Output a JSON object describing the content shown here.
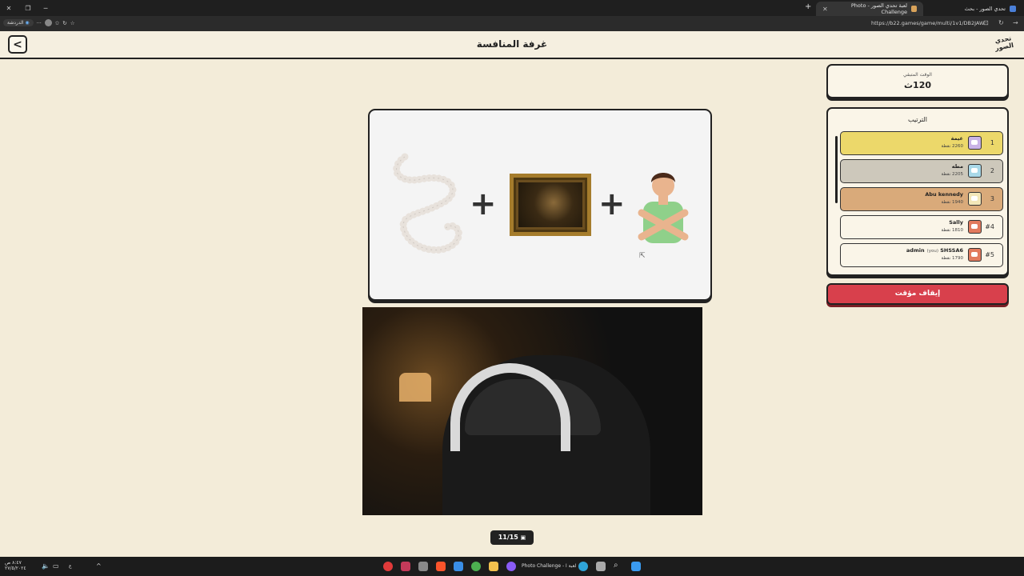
{
  "browser": {
    "tabs": [
      {
        "title": "تحدي الصور - بحث"
      },
      {
        "title": "لعبة تحدي الصور - Photo Challenge"
      }
    ],
    "url": "https://b22.games/game/multi/1v1/DB2JAW",
    "bookmark_label": "الدردشة"
  },
  "header": {
    "title": "غرفة المنافسة",
    "logo_text": "تحدي الصور"
  },
  "timer": {
    "label": "الوقت المتبقي",
    "value": "120ث"
  },
  "ranking": {
    "title": "الترتيب",
    "players": [
      {
        "rank": "1",
        "name": "غيمة",
        "score": "2260 نقطة",
        "you": "",
        "color": "#ecd86a",
        "avatar_color": "#c9b3e6"
      },
      {
        "rank": "2",
        "name": "مطه",
        "score": "2205 نقطة",
        "you": "",
        "color": "#cdc8bb",
        "avatar_color": "#a8d8e8"
      },
      {
        "rank": "3",
        "name": "Abu kennedy",
        "score": "1940 نقطة",
        "you": "",
        "color": "#d9aa7a",
        "avatar_color": "#f2e6b8"
      },
      {
        "rank": "#4",
        "name": "Sally",
        "score": "1810 نقطة",
        "you": "",
        "color": "#faf5e8",
        "avatar_color": "#e27a5e"
      },
      {
        "rank": "#5",
        "name": "SHSSA6",
        "score": "1790 نقطة",
        "you": "(you)",
        "prefix": "admin",
        "color": "#faf5e8",
        "avatar_color": "#e27a5e"
      }
    ]
  },
  "pause_button": "إيقاف مؤقت",
  "puzzle": {
    "items": [
      "pearl-necklace",
      "painting",
      "person-crossed-arms"
    ],
    "operator": "+"
  },
  "progress": "11/15",
  "taskbar": {
    "active_window": "لعبة ا - Photo Challenge",
    "clock_time": "٨:٤٧ ص",
    "clock_date": "٢٧/٥/٢٠٢٤"
  }
}
